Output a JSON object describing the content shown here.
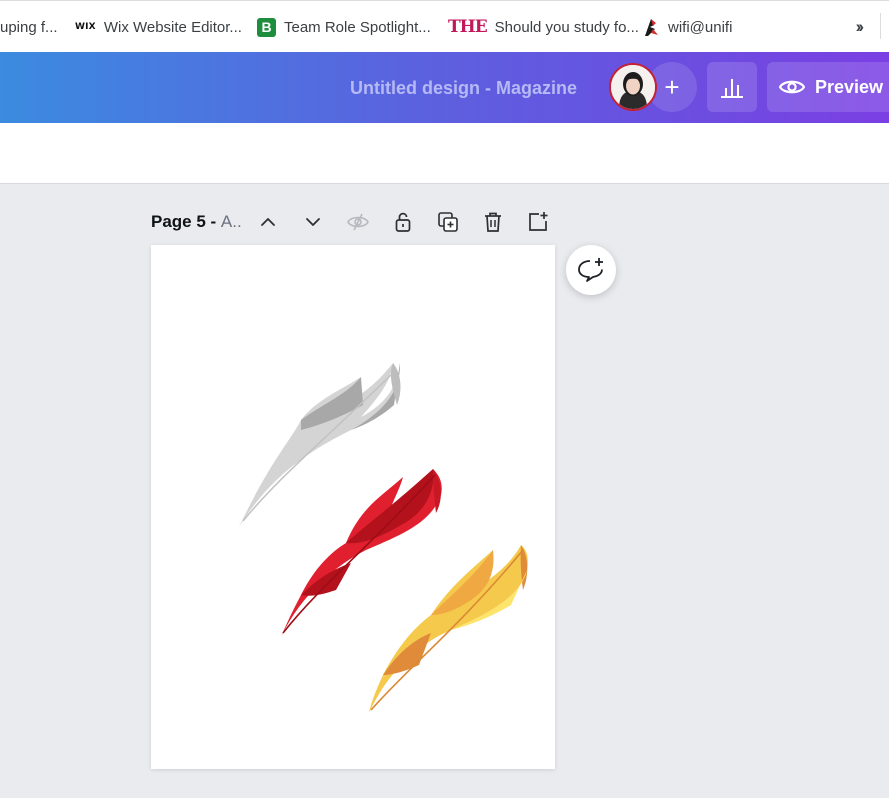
{
  "bookmarks": [
    {
      "label": "uping f...",
      "icon": "none"
    },
    {
      "label": "Wix Website Editor...",
      "icon": "wix-icon",
      "icon_text": "WIX"
    },
    {
      "label": "Team Role Spotlight...",
      "icon": "b-green-icon",
      "icon_text": "B"
    },
    {
      "label": "Should you study fo...",
      "icon": "the-icon",
      "icon_text": "THE"
    },
    {
      "label": "wifi@unifi",
      "icon": "unifi-icon"
    }
  ],
  "header": {
    "title": "Untitled design - Magazine",
    "add_collaborator": "+",
    "preview_label": "Preview"
  },
  "page_controls": {
    "page_label_bold": "Page 5 - ",
    "page_label_sub": "A.."
  },
  "colors": {
    "header_start": "#3b8be0",
    "header_end": "#7b3fe3",
    "canvas_bg": "#e9ebef",
    "feather_gray": "#a8a8a8",
    "feather_red": "#e0202e",
    "feather_yellow": "#f5c94c"
  }
}
